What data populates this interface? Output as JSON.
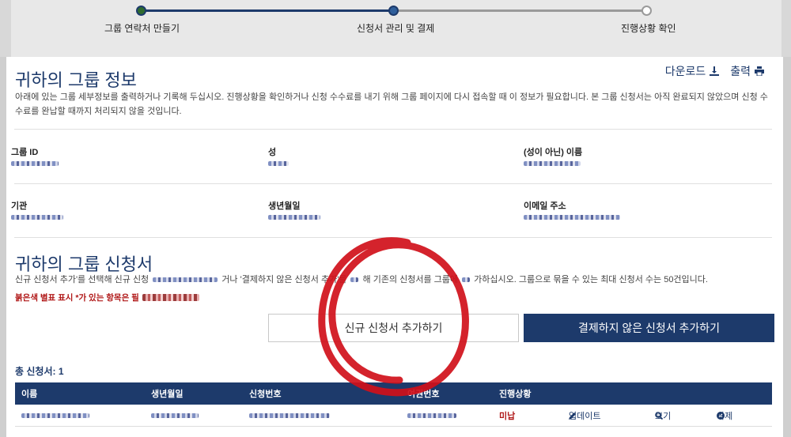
{
  "stepper": {
    "steps": [
      {
        "label": "그룹 연락처 만들기"
      },
      {
        "label": "신청서 관리 및 결제"
      },
      {
        "label": "진행상황 확인"
      }
    ]
  },
  "actions": {
    "download": "다운로드",
    "print": "출력"
  },
  "group_info": {
    "title": "귀하의 그룹 정보",
    "description": "아래에 있는 그룹 세부정보를 출력하거나 기록해 두십시오. 진행상황을 확인하거나 신청 수수료를 내기 위해 그룹 페이지에 다시 접속할 때 이 정보가 필요합니다. 본 그룹 신청서는 아직 완료되지 않았으며 신청 수수료를 완납할 때까지 처리되지 않을 것입니다.",
    "fields": {
      "group_id": "그룹 ID",
      "surname": "성",
      "given_name": "(성이 아닌) 이름",
      "organization": "기관",
      "birthdate": "생년월일",
      "email": "이메일 주소"
    }
  },
  "applications": {
    "title": "귀하의 그룹 신청서",
    "description_part1": "신규 신청서 추가'를 선택해 신규 신청",
    "description_part2": "거나 '결제하지 않은 신청서 추가'를",
    "description_part3": "해 기존의 신청서를 그룹에",
    "description_part4": "가하십시오. 그룹으로 묶을 수 있는 최대 신청서 수는 50건입니다.",
    "required_note": "붉은색 별표 표시 *가 있는 항목은 필",
    "add_new_button": "신규 신청서 추가하기",
    "add_unpaid_button": "결제하지 않은 신청서 추가하기",
    "total_label": "총 신청서: 1",
    "table": {
      "headers": [
        "이름",
        "생년월일",
        "신청번호",
        "여권번호",
        "진행상황"
      ],
      "row": {
        "status": "미납",
        "update": "업데이트",
        "view": "보기",
        "delete": "삭제"
      }
    }
  },
  "colors": {
    "brand": "#1d3a6b",
    "alert": "#b01717",
    "annotation": "#d0101a"
  }
}
